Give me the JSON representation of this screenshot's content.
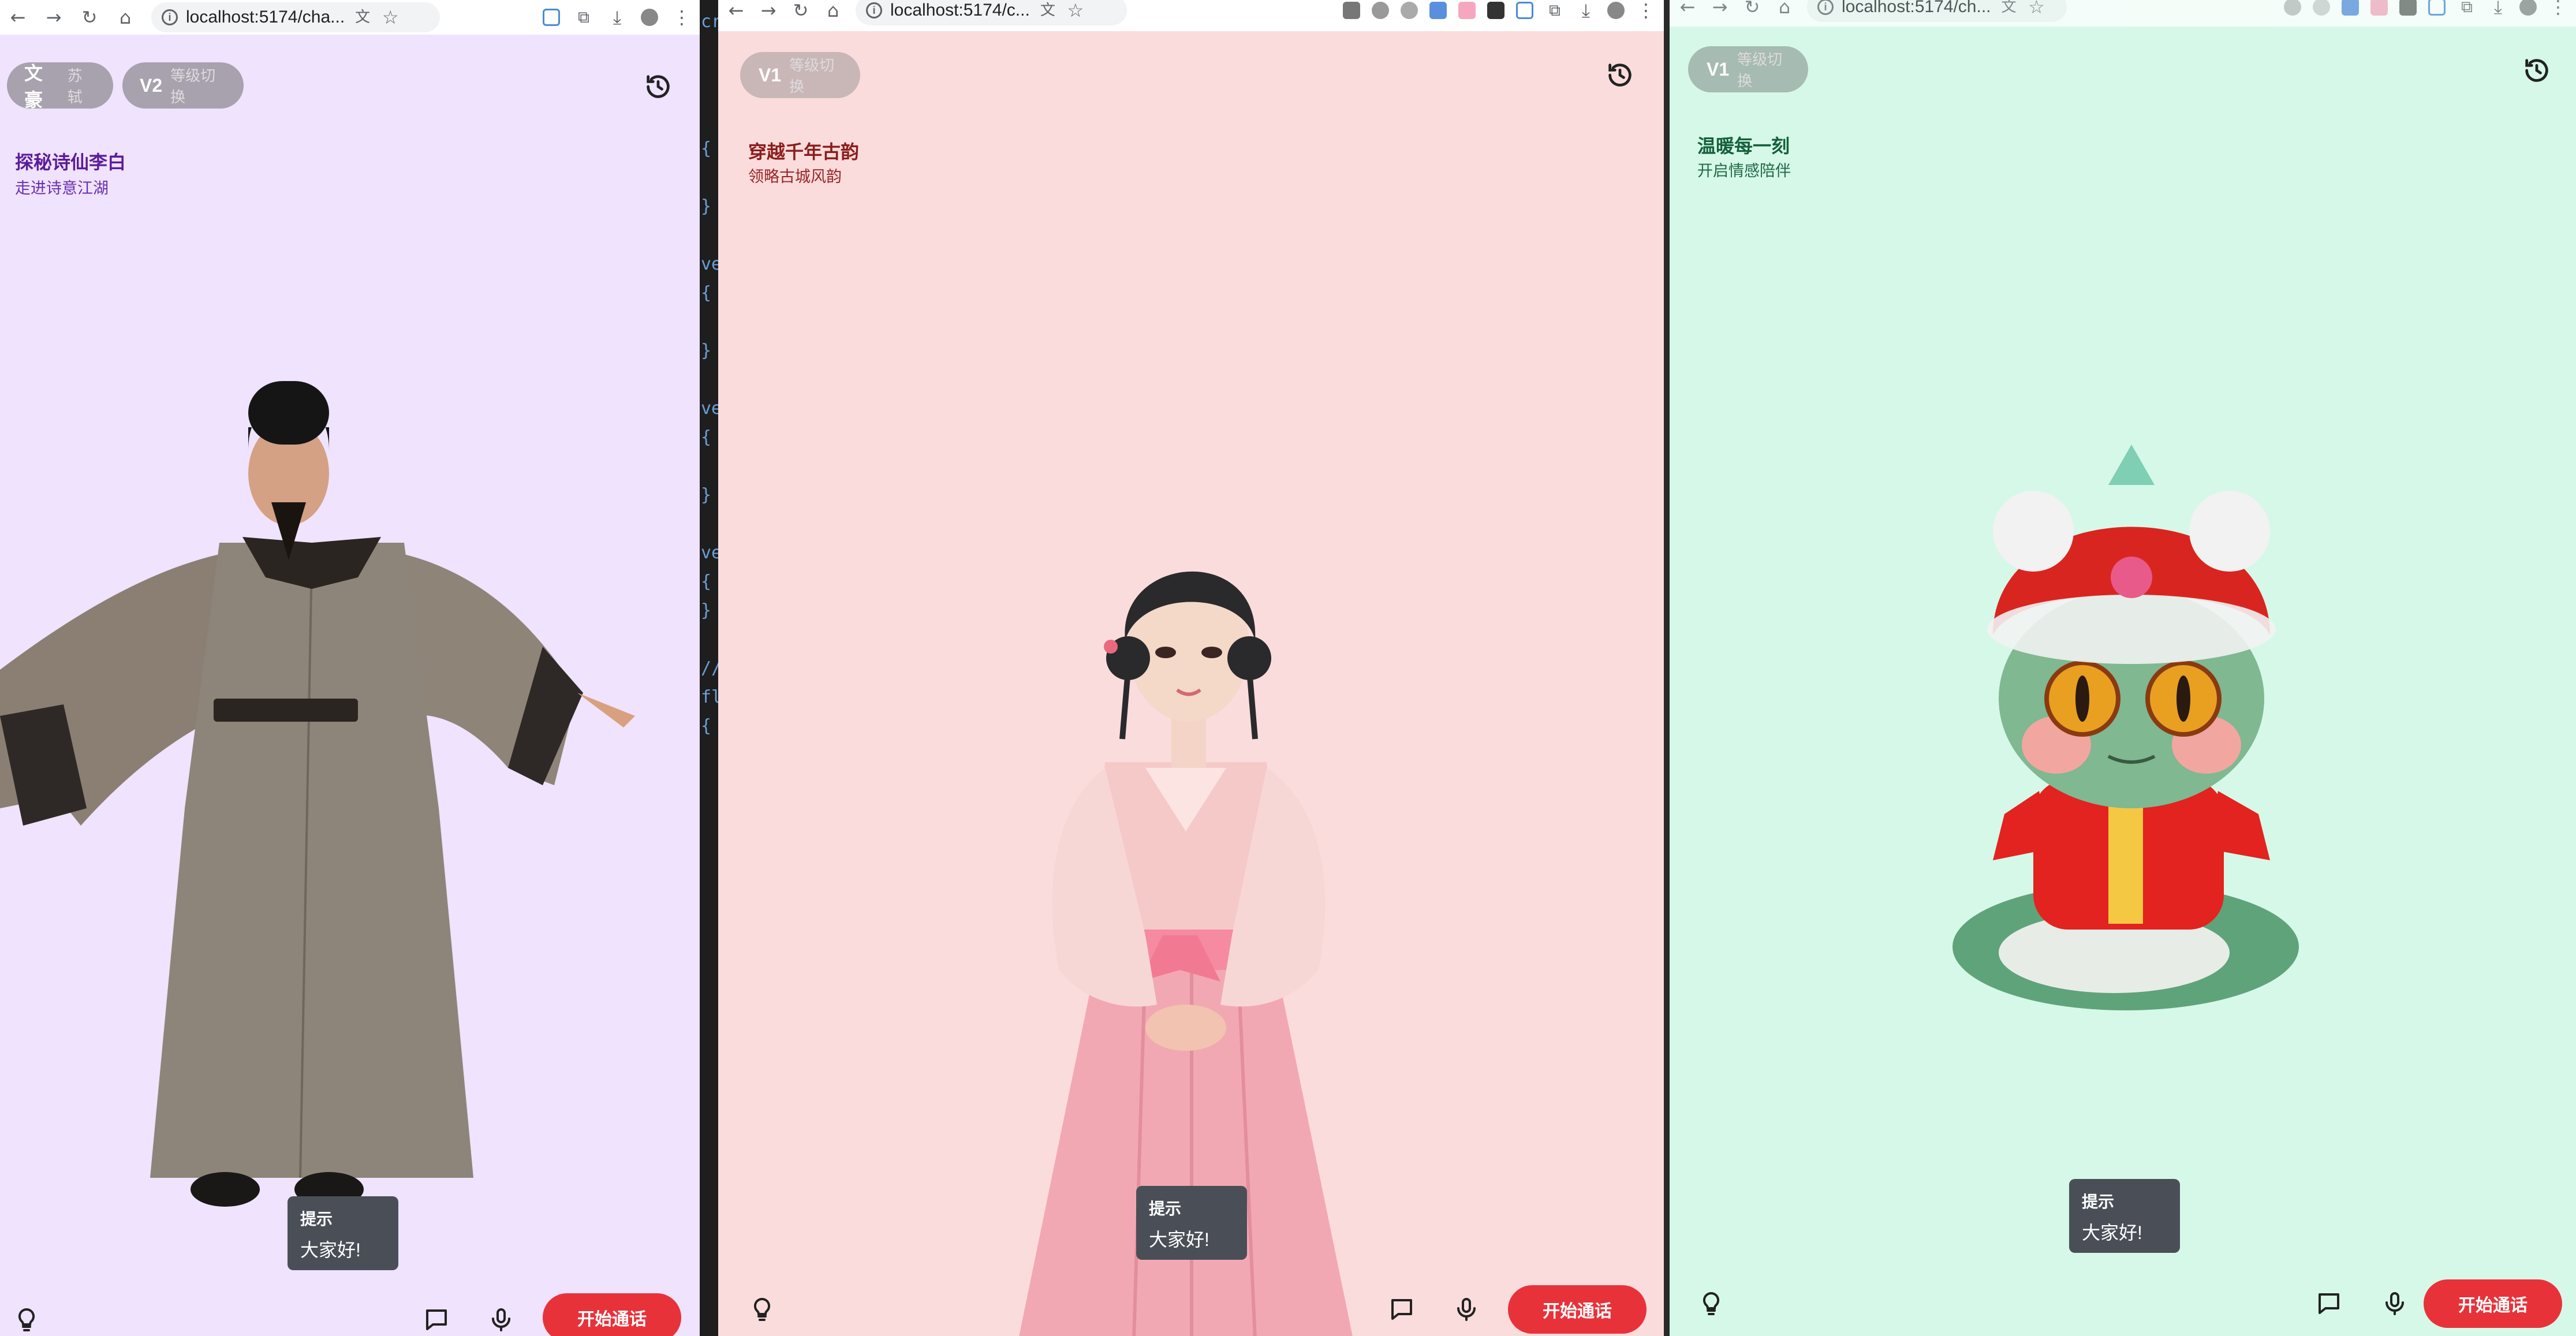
{
  "windows": [
    {
      "url": "localhost:5174/cha...",
      "pills": [
        {
          "strong": "文豪",
          "weak": "苏轼"
        },
        {
          "strong": "V2",
          "weak": "等级切换"
        }
      ],
      "title": "探秘诗仙李白",
      "subtitle": "走进诗意江湖",
      "avatar_icon": "scholar-figure",
      "tooltip": {
        "title": "提示",
        "body": "大家好!"
      },
      "call_button": "开始通话",
      "bg_color": "#efe3fd"
    },
    {
      "url": "localhost:5174/c...",
      "pills": [
        {
          "strong": "V1",
          "weak": "等级切换"
        }
      ],
      "title": "穿越千年古韵",
      "subtitle": "领略古城风韵",
      "avatar_icon": "hanfu-girl-figure",
      "tooltip": {
        "title": "提示",
        "body": "大家好!"
      },
      "call_button": "开始通话",
      "bg_color": "#fbdcdc"
    },
    {
      "url": "localhost:5174/ch...",
      "pills": [
        {
          "strong": "V1",
          "weak": "等级切换"
        }
      ],
      "title": "温暖每一刻",
      "subtitle": "开启情感陪伴",
      "avatar_icon": "lion-dance-snake-figure",
      "tooltip": {
        "title": "提示",
        "body": "大家好!"
      },
      "call_button": "开始通话",
      "bg_color": "#d6f8e8"
    }
  ],
  "editor_snippets": [
    "cr",
    "{",
    "}",
    "ve",
    "{",
    "}",
    "ve",
    "{",
    "}",
    "ve",
    "{",
    "}",
    "//",
    "fl",
    "{"
  ],
  "colors": {
    "call_button": "#e8323a",
    "tooltip": "#4a4f57"
  }
}
